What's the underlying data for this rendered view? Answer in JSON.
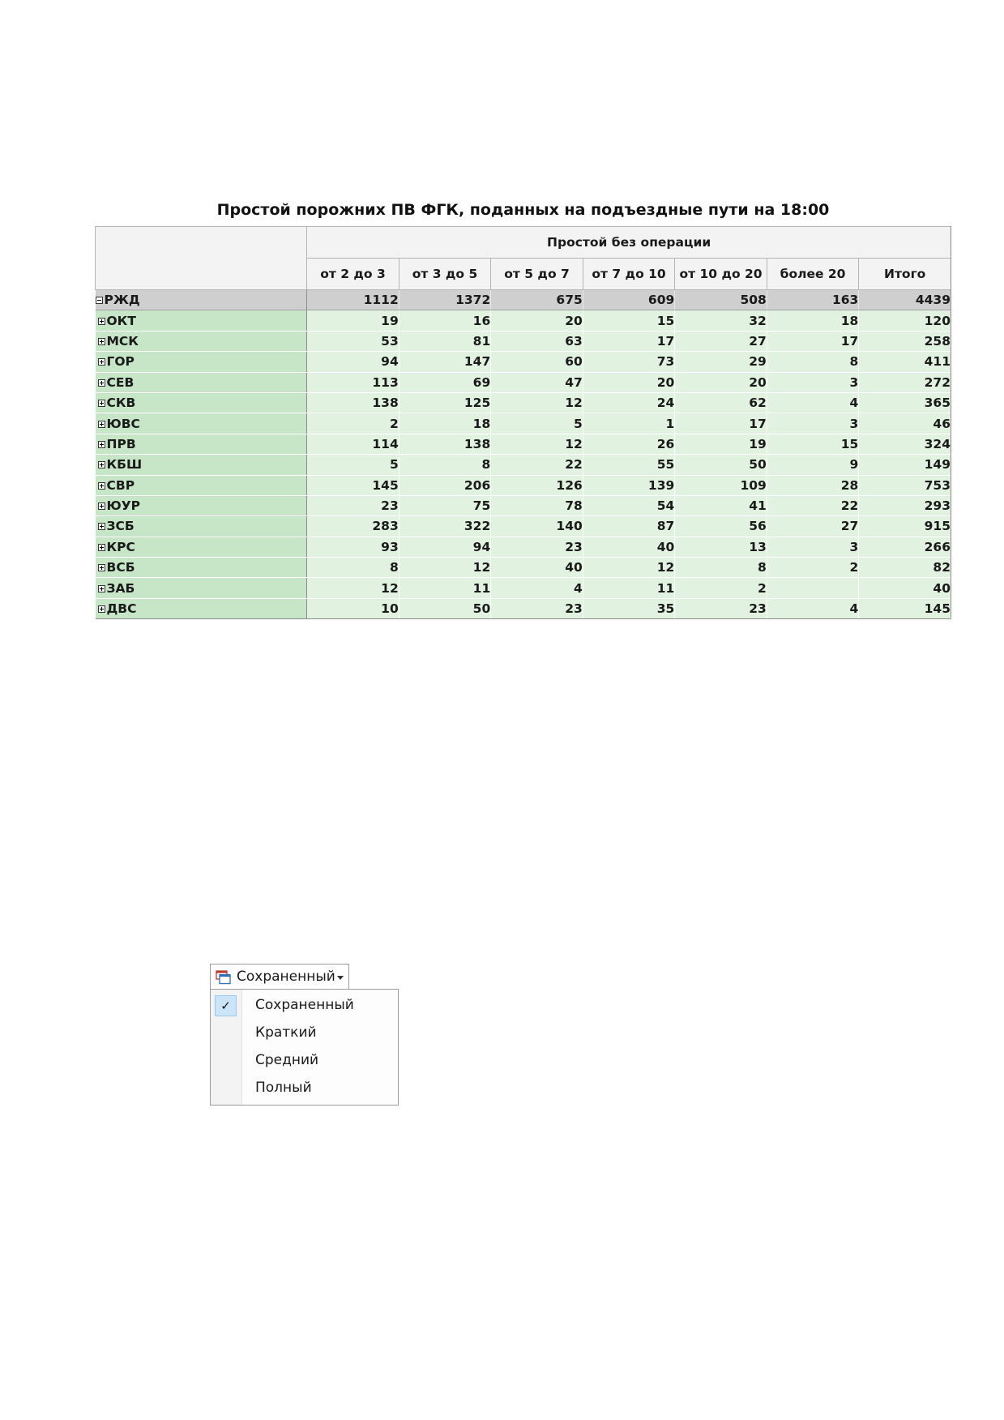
{
  "report": {
    "title": "Простой порожних ПВ ФГК, поданных на подъездные пути на 18:00",
    "group_header": "Простой без операции",
    "columns": [
      "от 2 до 3",
      "от 3 до 5",
      "от 5 до 7",
      "от 7 до 10",
      "от 10 до 20",
      "более 20",
      "Итого"
    ],
    "total_row": {
      "label": "РЖД",
      "expander": "collapse",
      "values": [
        "1112",
        "1372",
        "675",
        "609",
        "508",
        "163",
        "4439"
      ]
    },
    "rows": [
      {
        "label": "ОКТ",
        "values": [
          "19",
          "16",
          "20",
          "15",
          "32",
          "18",
          "120"
        ]
      },
      {
        "label": "МСК",
        "values": [
          "53",
          "81",
          "63",
          "17",
          "27",
          "17",
          "258"
        ]
      },
      {
        "label": "ГОР",
        "values": [
          "94",
          "147",
          "60",
          "73",
          "29",
          "8",
          "411"
        ]
      },
      {
        "label": "СЕВ",
        "values": [
          "113",
          "69",
          "47",
          "20",
          "20",
          "3",
          "272"
        ]
      },
      {
        "label": "СКВ",
        "values": [
          "138",
          "125",
          "12",
          "24",
          "62",
          "4",
          "365"
        ]
      },
      {
        "label": "ЮВС",
        "values": [
          "2",
          "18",
          "5",
          "1",
          "17",
          "3",
          "46"
        ]
      },
      {
        "label": "ПРВ",
        "values": [
          "114",
          "138",
          "12",
          "26",
          "19",
          "15",
          "324"
        ]
      },
      {
        "label": "КБШ",
        "values": [
          "5",
          "8",
          "22",
          "55",
          "50",
          "9",
          "149"
        ]
      },
      {
        "label": "СВР",
        "values": [
          "145",
          "206",
          "126",
          "139",
          "109",
          "28",
          "753"
        ]
      },
      {
        "label": "ЮУР",
        "values": [
          "23",
          "75",
          "78",
          "54",
          "41",
          "22",
          "293"
        ]
      },
      {
        "label": "ЗСБ",
        "values": [
          "283",
          "322",
          "140",
          "87",
          "56",
          "27",
          "915"
        ]
      },
      {
        "label": "КРС",
        "values": [
          "93",
          "94",
          "23",
          "40",
          "13",
          "3",
          "266"
        ]
      },
      {
        "label": "ВСБ",
        "values": [
          "8",
          "12",
          "40",
          "12",
          "8",
          "2",
          "82"
        ]
      },
      {
        "label": "ЗАБ",
        "values": [
          "12",
          "11",
          "4",
          "11",
          "2",
          "",
          "40"
        ]
      },
      {
        "label": "ДВС",
        "values": [
          "10",
          "50",
          "23",
          "35",
          "23",
          "4",
          "145"
        ]
      }
    ],
    "colors": {
      "row_label_bg": "#c7e6c7",
      "cell_bg": "#e2f2e0",
      "total_row_bg": "#cfcfcf",
      "header_bg": "#f3f3f3"
    }
  },
  "layout_dropdown": {
    "button_label": "Сохраненный",
    "button_icon": "layout-icon",
    "items": [
      {
        "label": "Сохраненный",
        "checked": true
      },
      {
        "label": "Краткий",
        "checked": false
      },
      {
        "label": "Средний",
        "checked": false
      },
      {
        "label": "Полный",
        "checked": false
      }
    ],
    "check_color": "#cce4f7"
  }
}
